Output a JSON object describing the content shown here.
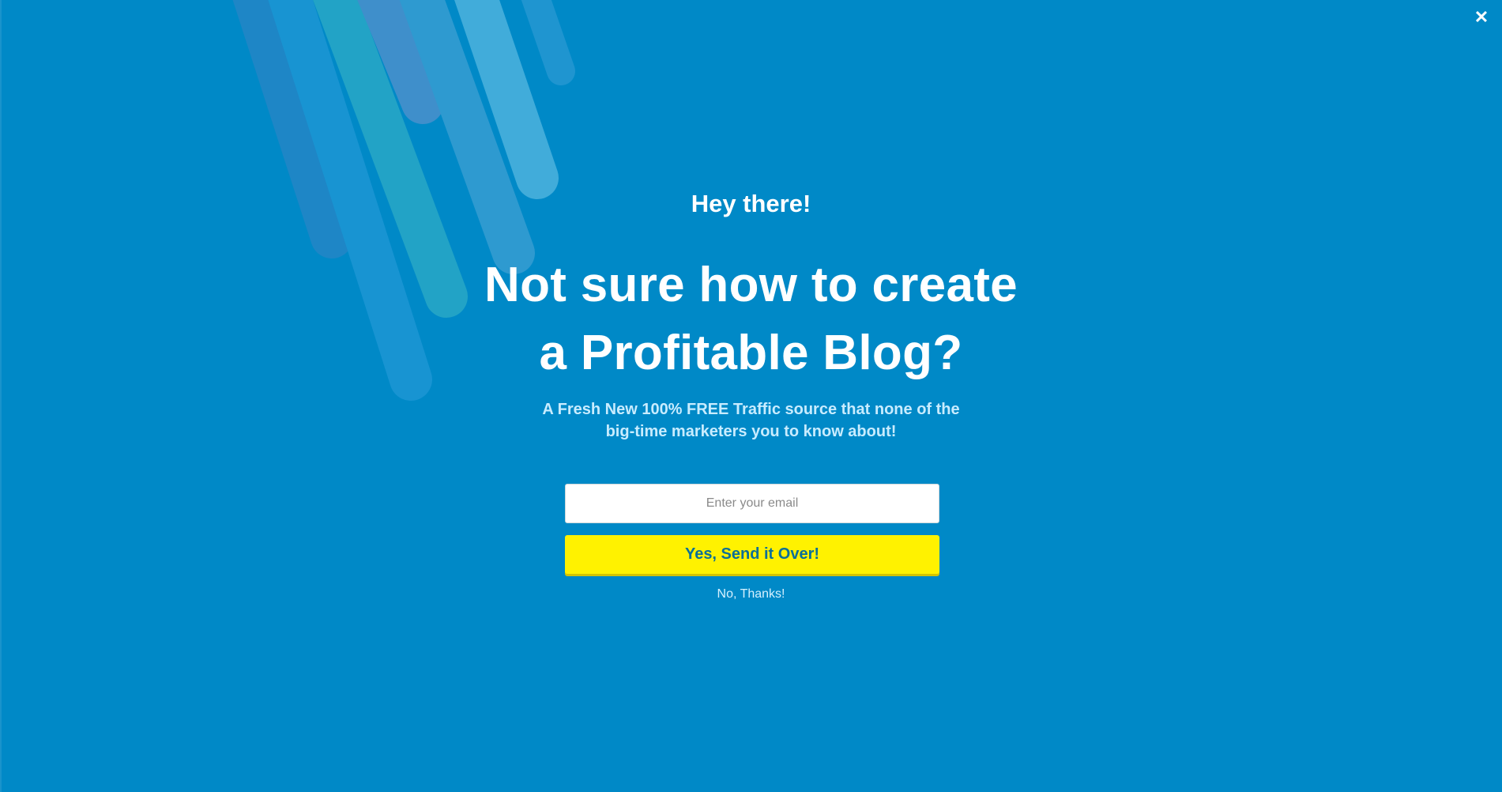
{
  "popup": {
    "close_icon": "close-icon",
    "close_glyph": "✕",
    "greeting": "Hey there!",
    "headline_line1": "Not sure how to create",
    "headline_line2": "a Profitable Blog?",
    "subtext_line1": "A Fresh New 100% FREE Traffic source that none of the",
    "subtext_line2": "big-time marketers you to know about!",
    "email_placeholder": "Enter your email",
    "email_value": "",
    "submit_label": "Yes, Send it Over!",
    "decline_label": "No, Thanks!"
  },
  "colors": {
    "background": "#0089c7",
    "button": "#fff200",
    "button_text": "#0a6f98",
    "subtext": "#c8ecff"
  }
}
